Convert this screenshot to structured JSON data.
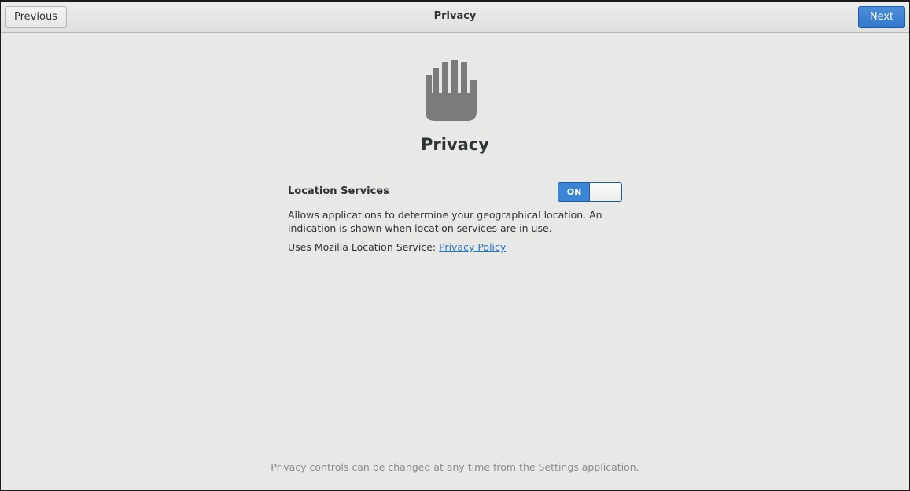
{
  "header": {
    "title": "Privacy",
    "previous_label": "Previous",
    "next_label": "Next"
  },
  "main": {
    "icon": "hand-stop-icon",
    "title": "Privacy",
    "location_services": {
      "label": "Location Services",
      "toggle_text": "ON",
      "toggle_state": "on",
      "description": "Allows applications to determine your geographical location. An indication is shown when location services are in use.",
      "uses_prefix": "Uses Mozilla Location Service: ",
      "policy_link": "Privacy Policy"
    },
    "footer": "Privacy controls can be changed at any time from the Settings application."
  },
  "colors": {
    "accent": "#3a85d6",
    "link": "#2a76c6",
    "icon": "#7b7b7b",
    "footer_text": "#8a8d8a"
  }
}
